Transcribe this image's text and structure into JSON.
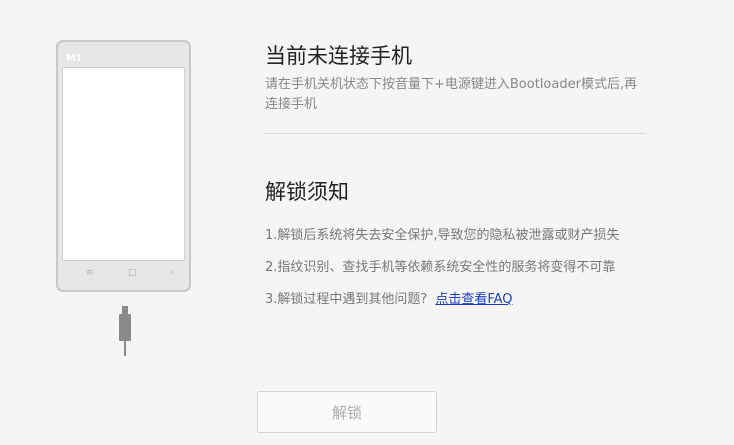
{
  "phone": {
    "logo": "MI",
    "keys": {
      "menu": "≡",
      "home": "□",
      "back": "‹"
    }
  },
  "connect": {
    "title": "当前未连接手机",
    "instruction": "请在手机关机状态下按音量下+电源键进入Bootloader模式后,再连接手机"
  },
  "notice": {
    "title": "解锁须知",
    "items": [
      "1.解锁后系统将失去安全保护,导致您的隐私被泄露或财产损失",
      "2.指纹识别、查找手机等依赖系统安全性的服务将变得不可靠",
      "3.解锁过程中遇到其他问题?"
    ],
    "faq_link": "点击查看FAQ"
  },
  "actions": {
    "unlock_label": "解锁"
  }
}
